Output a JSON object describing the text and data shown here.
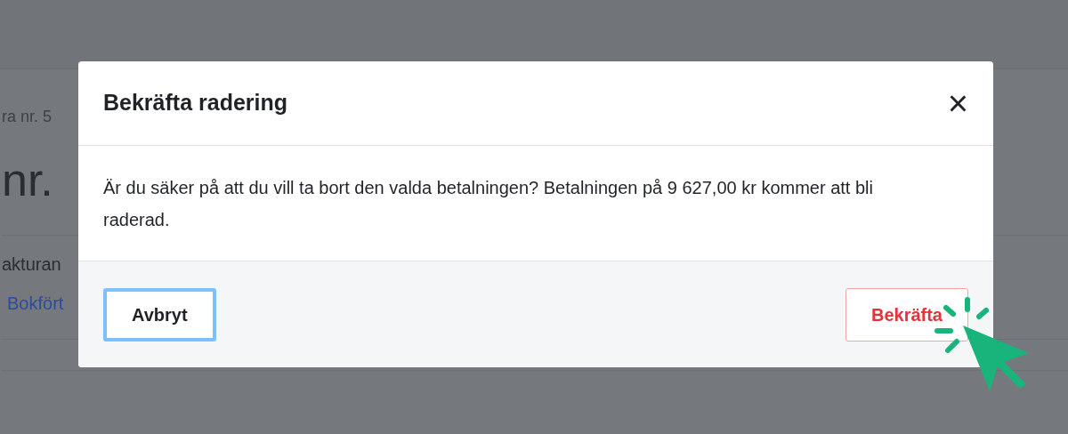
{
  "background": {
    "breadcrumb": "ra nr. 5",
    "heading": "nr.",
    "description": "akturan",
    "link": "Bokfört"
  },
  "dialog": {
    "title": "Bekräfta radering",
    "close": "×",
    "message": "Är du säker på att du vill ta bort den valda betalningen? Betalningen på 9 627,00 kr kommer att bli raderad.",
    "buttons": [
      {
        "label": "Avbryt",
        "kind": "secondary",
        "focused": true
      },
      {
        "label": "Bekräfta",
        "kind": "danger",
        "focused": false
      }
    ]
  }
}
